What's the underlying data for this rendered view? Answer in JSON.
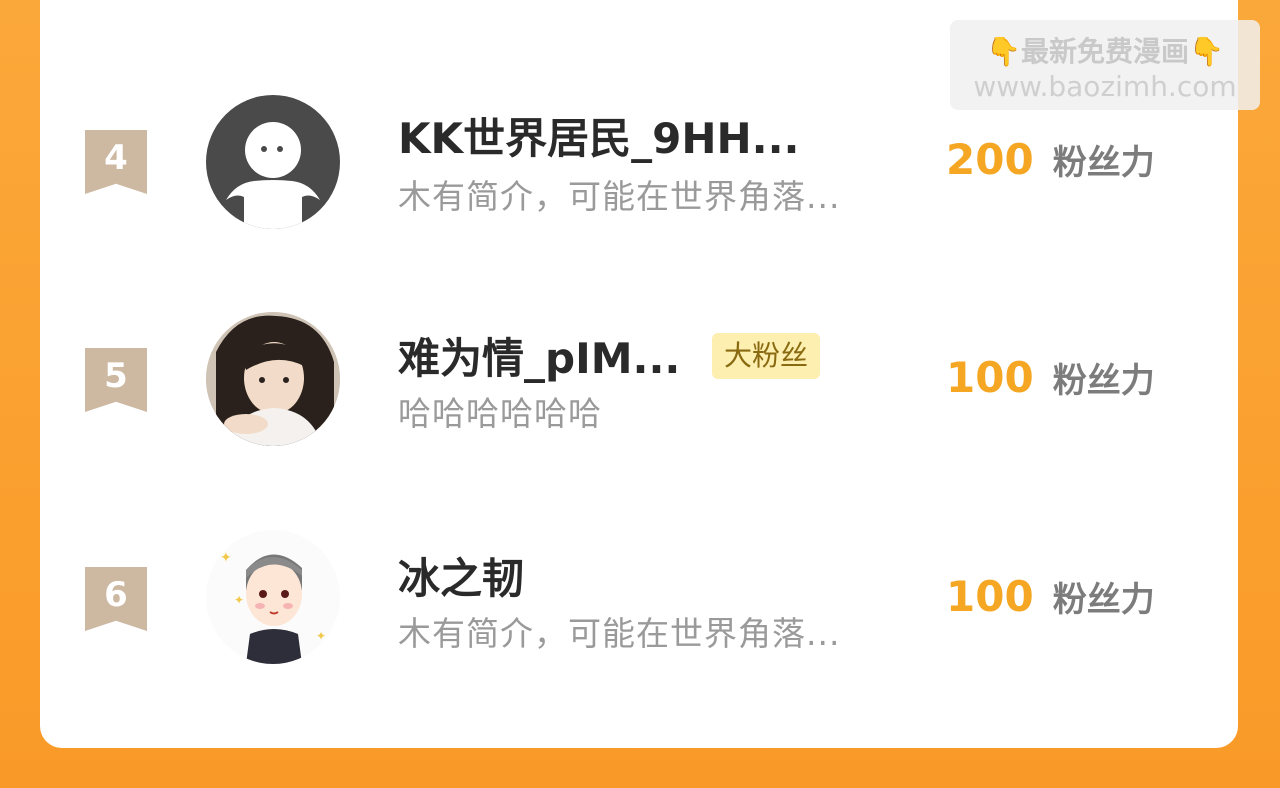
{
  "watermark": {
    "line1": "👇最新免费漫画👇",
    "line2": "www.baozimh.com"
  },
  "ranking": [
    {
      "rank": "4",
      "name": "KK世界居民_9HH...",
      "bio": "木有简介，可能在世界角落...",
      "badge": "",
      "score": "200",
      "unit": "粉丝力",
      "avatar": "default-ghost-avatar"
    },
    {
      "rank": "5",
      "name": "难为情_pIM...",
      "bio": "哈哈哈哈哈哈",
      "badge": "大粉丝",
      "score": "100",
      "unit": "粉丝力",
      "avatar": "photo-avatar"
    },
    {
      "rank": "6",
      "name": "冰之韧",
      "bio": "木有简介，可能在世界角落...",
      "badge": "",
      "score": "100",
      "unit": "粉丝力",
      "avatar": "cartoon-avatar"
    }
  ],
  "colors": {
    "background": "#fba83a",
    "score": "#f5a623",
    "rank_badge": "#cdb8a2",
    "fan_badge": "#fcefb0"
  }
}
